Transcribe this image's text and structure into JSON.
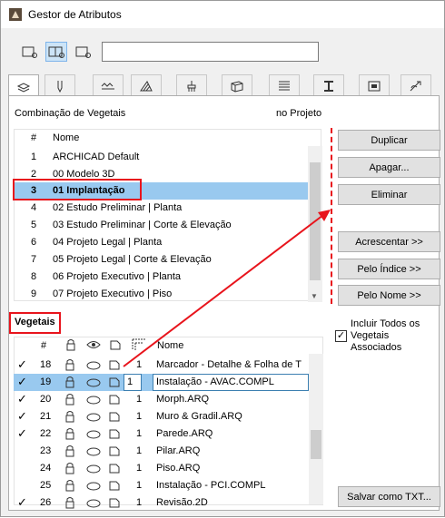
{
  "window": {
    "title": "Gestor de Atributos"
  },
  "search": {
    "value": ""
  },
  "combo": {
    "header": "Combinação de Vegetais",
    "project_header": "no Projeto",
    "col_hash": "#",
    "col_name": "Nome",
    "rows": [
      {
        "num": "1",
        "name": " ARCHICAD Default"
      },
      {
        "num": "2",
        "name": "00 Modelo 3D"
      },
      {
        "num": "3",
        "name": "01 Implantação"
      },
      {
        "num": "4",
        "name": "02 Estudo Preliminar | Planta"
      },
      {
        "num": "5",
        "name": "03 Estudo Preliminar | Corte & Elevação"
      },
      {
        "num": "6",
        "name": "04 Projeto Legal | Planta"
      },
      {
        "num": "7",
        "name": "05 Projeto Legal | Corte & Elevação"
      },
      {
        "num": "8",
        "name": "06 Projeto Executivo | Planta"
      },
      {
        "num": "9",
        "name": "07 Projeto Executivo | Piso"
      }
    ]
  },
  "buttons": {
    "duplicar": "Duplicar",
    "apagar": "Apagar...",
    "eliminar": "Eliminar",
    "acrescentar": "Acrescentar >>",
    "pelo_indice": "Pelo Índice >>",
    "pelo_nome": "Pelo Nome >>",
    "salvar_txt": "Salvar como TXT..."
  },
  "vegetais": {
    "header": "Vegetais",
    "col_hash": "#",
    "col_name": "Nome",
    "include_label_1": "Incluir Todos os",
    "include_label_2": "Vegetais",
    "include_label_3": "Associados",
    "include_checked": true,
    "rows": [
      {
        "check": "✓",
        "num": "18",
        "val": "1",
        "name": "Marcador - Detalhe & Folha de T"
      },
      {
        "check": "✓",
        "num": "19",
        "val": "1",
        "name": "Instalação - AVAC.COMPL"
      },
      {
        "check": "✓",
        "num": "20",
        "val": "1",
        "name": "Morph.ARQ"
      },
      {
        "check": "✓",
        "num": "21",
        "val": "1",
        "name": "Muro & Gradil.ARQ"
      },
      {
        "check": "✓",
        "num": "22",
        "val": "1",
        "name": "Parede.ARQ"
      },
      {
        "check": "",
        "num": "23",
        "val": "1",
        "name": "Pilar.ARQ"
      },
      {
        "check": "",
        "num": "24",
        "val": "1",
        "name": "Piso.ARQ"
      },
      {
        "check": "",
        "num": "25",
        "val": "1",
        "name": "Instalação - PCI.COMPL"
      },
      {
        "check": "✓",
        "num": "26",
        "val": "1",
        "name": "Revisão.2D"
      }
    ]
  }
}
